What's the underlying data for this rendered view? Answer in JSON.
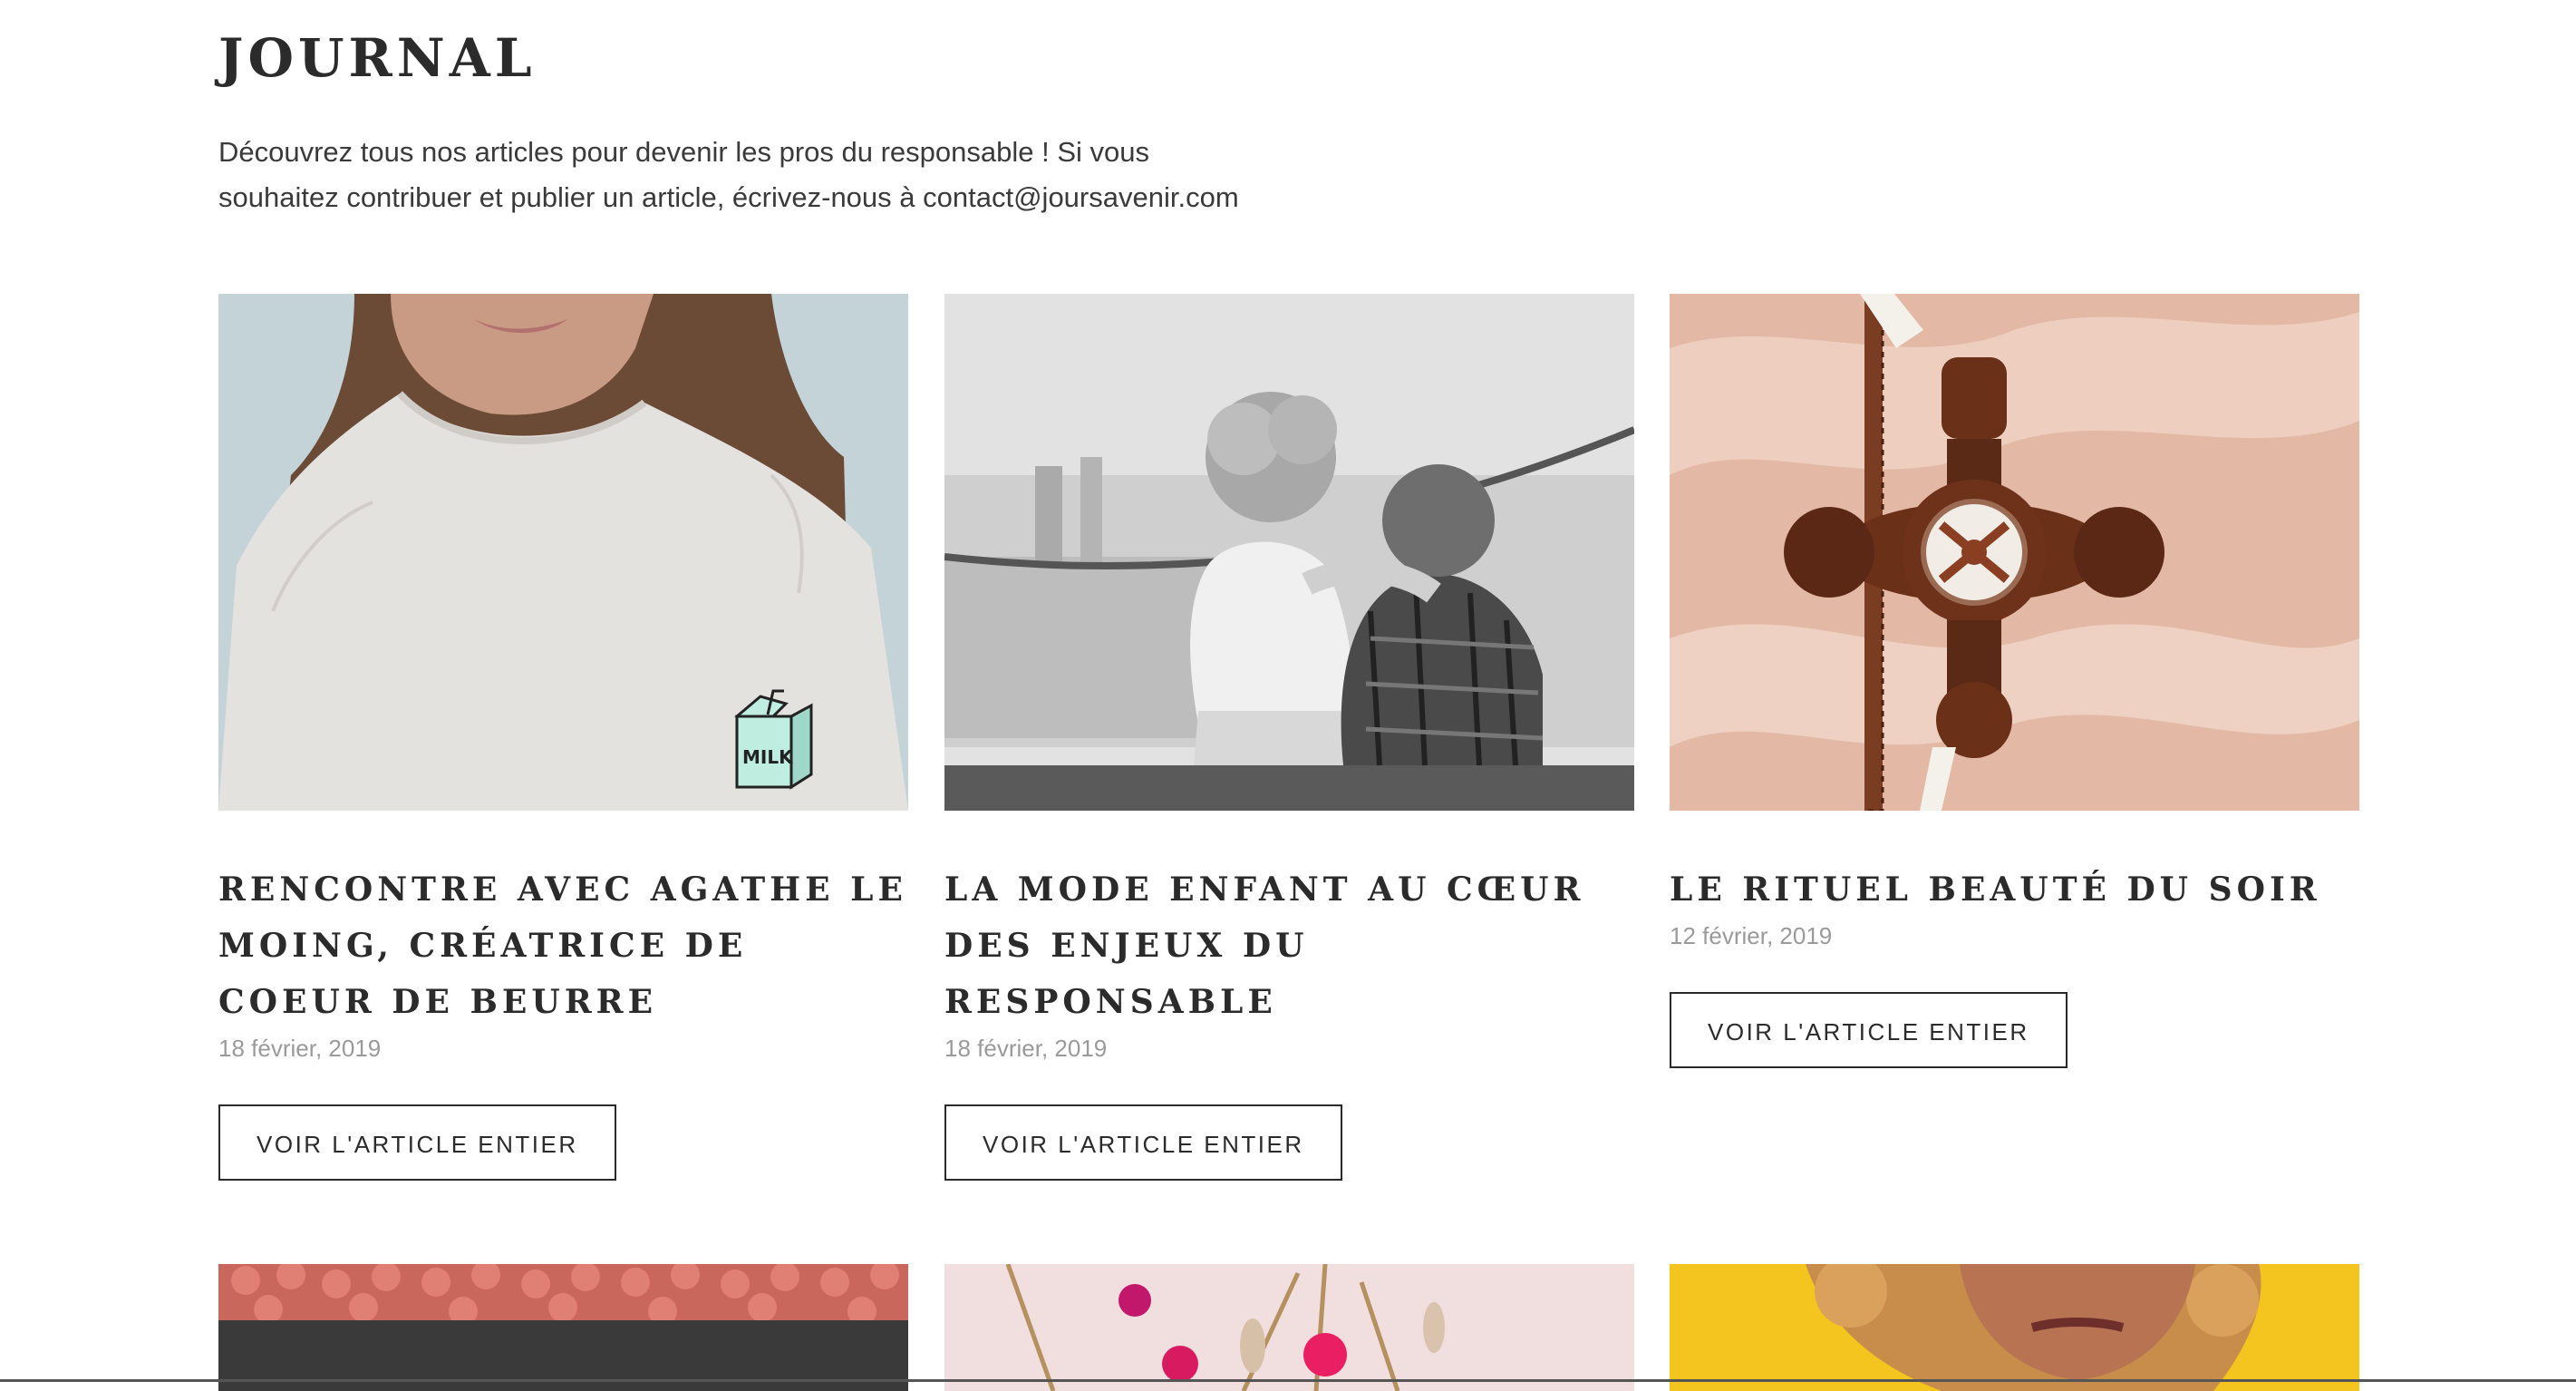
{
  "header": {
    "title": "JOURNAL",
    "intro_line1": "Découvrez tous nos articles pour devenir les pros du responsable ! Si vous",
    "intro_line2": "souhaitez contribuer et publier un article, écrivez-nous à contact@joursavenir.com"
  },
  "articles": [
    {
      "title": "RENCONTRE AVEC AGATHE LE MOING, CRÉATRICE DE COEUR DE BEURRE",
      "date": "18 février, 2019",
      "button": "VOIR L'ARTICLE ENTIER",
      "image_subject": "girl-sweater-milk-icon",
      "badge_text": "MILK"
    },
    {
      "title": "LA MODE ENFANT AU CŒUR DES ENJEUX DU RESPONSABLE",
      "date": "18 février, 2019",
      "button": "VOIR L'ARTICLE ENTIER",
      "image_subject": "two-children-bw"
    },
    {
      "title": "LE RITUEL BEAUTÉ DU SOIR",
      "date": "12 février, 2019",
      "button": "VOIR L'ARTICLE ENTIER",
      "image_subject": "copper-shower-tap"
    }
  ],
  "second_row": [
    {
      "image_subject": "apples-tray"
    },
    {
      "image_subject": "dried-flowers"
    },
    {
      "image_subject": "curly-hair-woman-yellow"
    }
  ],
  "colors": {
    "text": "#2b2b2b",
    "muted": "#9a9a9a",
    "border": "#2b2b2b"
  }
}
